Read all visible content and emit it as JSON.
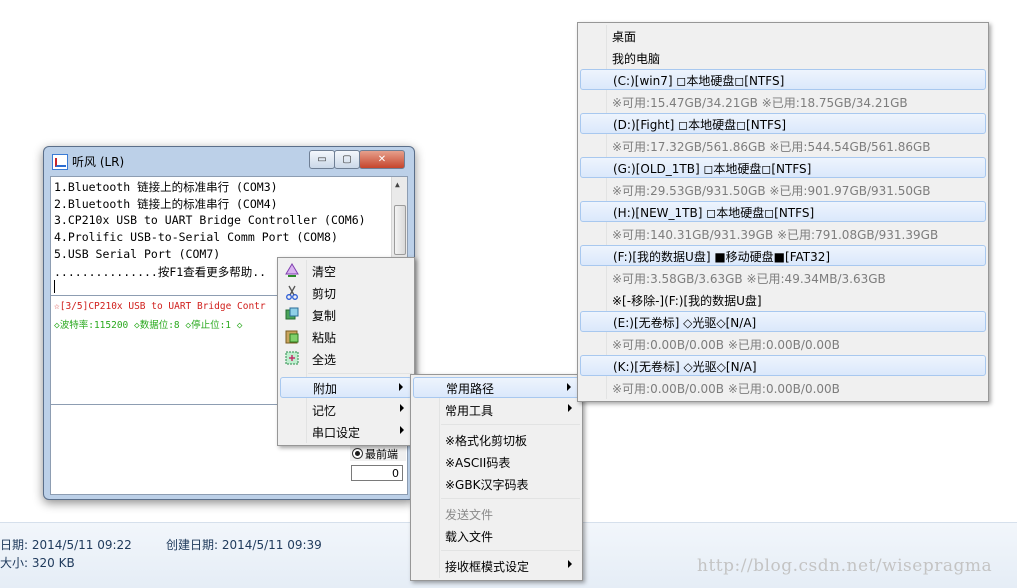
{
  "window": {
    "title": "听风 (LR)",
    "min_glyph": "▭",
    "max_glyph": "▢",
    "close_glyph": "✕"
  },
  "ports": [
    "1.Bluetooth 链接上的标准串行 (COM3)",
    "2.Bluetooth 链接上的标准串行 (COM4)",
    "3.CP210x USB to UART Bridge Controller (COM6)",
    "4.Prolific USB-to-Serial Comm Port (COM8)",
    "5.USB Serial Port (COM7)",
    "...............按F1查看更多帮助.."
  ],
  "log": {
    "line1": "☆[3/5]CP210x USB to UART Bridge Contr",
    "line2": "◇波特率:115200 ◇数据位:8 ◇停止位:1 ◇"
  },
  "send_options": {
    "front_label": "最前端",
    "count_value": "0"
  },
  "context_menu": {
    "items": [
      {
        "label": "清空",
        "icon": "clear-icon"
      },
      {
        "label": "剪切",
        "icon": "scissors-icon"
      },
      {
        "label": "复制",
        "icon": "copy-icon"
      },
      {
        "label": "粘贴",
        "icon": "paste-icon"
      },
      {
        "label": "全选",
        "icon": "select-all-icon"
      },
      {
        "label": "附加"
      },
      {
        "label": "记忆"
      },
      {
        "label": "串口设定"
      }
    ]
  },
  "addon_menu": {
    "items": [
      {
        "label": "常用路径"
      },
      {
        "label": "常用工具"
      },
      {
        "label": "※格式化剪切板"
      },
      {
        "label": "※ASCII码表"
      },
      {
        "label": "※GBK汉字码表"
      },
      {
        "label": "发送文件"
      },
      {
        "label": "载入文件"
      },
      {
        "label": "接收框模式设定"
      }
    ]
  },
  "paths_menu": {
    "items": [
      {
        "label": "桌面"
      },
      {
        "label": "我的电脑"
      },
      {
        "label": "(C:)[win7]   ◻本地硬盘◻[NTFS]"
      },
      {
        "label": "※可用:15.47GB/34.21GB     ※已用:18.75GB/34.21GB"
      },
      {
        "label": "(D:)[Fight]   ◻本地硬盘◻[NTFS]"
      },
      {
        "label": "※可用:17.32GB/561.86GB     ※已用:544.54GB/561.86GB"
      },
      {
        "label": "(G:)[OLD_1TB]   ◻本地硬盘◻[NTFS]"
      },
      {
        "label": "※可用:29.53GB/931.50GB     ※已用:901.97GB/931.50GB"
      },
      {
        "label": "(H:)[NEW_1TB]   ◻本地硬盘◻[NTFS]"
      },
      {
        "label": "※可用:140.31GB/931.39GB     ※已用:791.08GB/931.39GB"
      },
      {
        "label": "(F:)[我的数据U盘]   ■移动硬盘■[FAT32]"
      },
      {
        "label": "※可用:3.58GB/3.63GB     ※已用:49.34MB/3.63GB"
      },
      {
        "label": "※[-移除-](F:)[我的数据U盘]"
      },
      {
        "label": "(E:)[无卷标]    ◇光驱◇[N/A]"
      },
      {
        "label": "※可用:0.00B/0.00B     ※已用:0.00B/0.00B"
      },
      {
        "label": "(K:)[无卷标]    ◇光驱◇[N/A]"
      },
      {
        "label": "※可用:0.00B/0.00B     ※已用:0.00B/0.00B"
      }
    ]
  },
  "status": {
    "modified": "日期: 2014/5/11 09:22",
    "created": "创建日期: 2014/5/11 09:39",
    "size": "大小: 320 KB"
  },
  "watermark": "http://blog.csdn.net/wisepragma"
}
